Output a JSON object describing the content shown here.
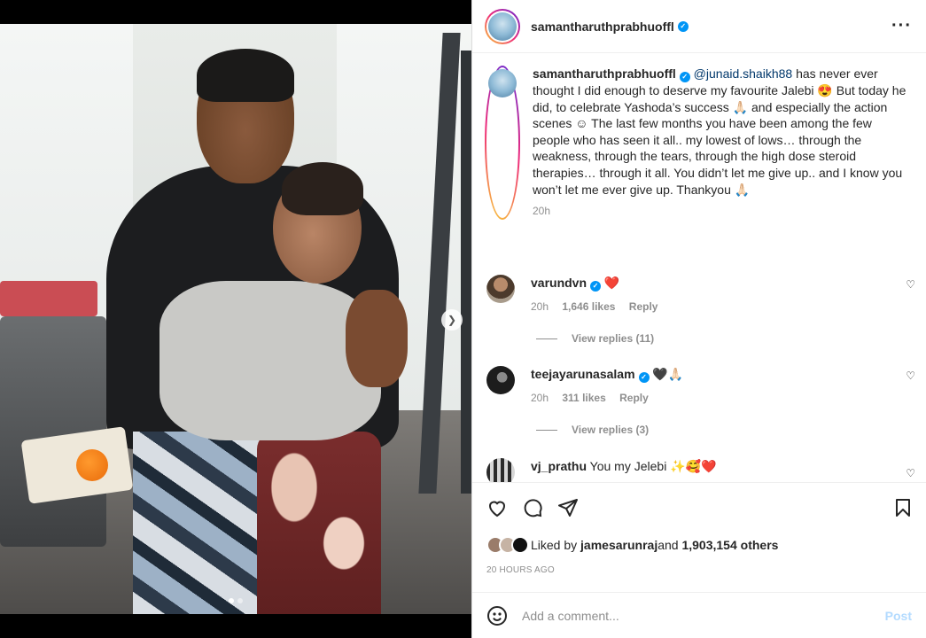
{
  "post": {
    "username": "samantharuthprabhuoffl",
    "more_icon": "more-horizontal-icon"
  },
  "caption": {
    "username": "samantharuthprabhuoffl",
    "mention": "@junaid.shaikh88",
    "text": " has never ever thought I did enough to deserve my favourite Jalebi 😍 But today he did, to celebrate Yashoda’s success 🙏🏻 and especially the action scenes ☺ The last few months you have been among the few people who has seen it all.. my lowest of lows… through the weakness, through the tears, through the high dose steroid therapies… through it all. You didn’t let me give up.. and I know you won’t let me ever give up. Thankyou 🙏🏻",
    "time": "20h"
  },
  "comments": [
    {
      "username": "varundvn",
      "text": "❤️",
      "time": "20h",
      "likes": "1,646 likes",
      "reply": "Reply",
      "view_replies": "View replies (11)"
    },
    {
      "username": "teejayarunasalam",
      "text": "🖤🙏🏻",
      "time": "20h",
      "likes": "311 likes",
      "reply": "Reply",
      "view_replies": "View replies (3)"
    },
    {
      "username": "vj_prathu",
      "text": "You my Jelebi ✨🥰❤️"
    }
  ],
  "actions": {
    "liked_by_prefix": "Liked by ",
    "liked_by_user": "jamesarunraj",
    "and": " and ",
    "others": "1,903,154 others",
    "time_ago": "20 HOURS AGO"
  },
  "add_comment": {
    "placeholder": "Add a comment...",
    "post_label": "Post"
  },
  "colors": {
    "verified": "#0095f6",
    "link": "#00376b",
    "muted": "#8e8e8e",
    "post_disabled": "#b3dbff"
  }
}
